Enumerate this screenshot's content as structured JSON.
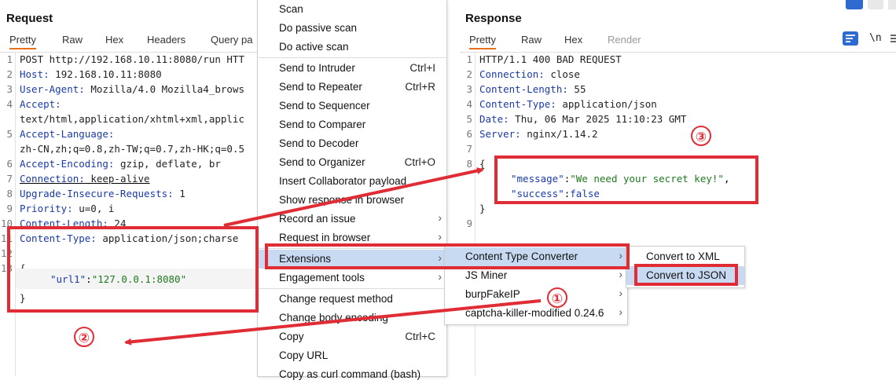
{
  "request": {
    "title": "Request",
    "tabs": [
      "Pretty",
      "Raw",
      "Hex",
      "Headers",
      "Query pa"
    ],
    "lines": [
      {
        "n": "1",
        "k": "",
        "v": "POST http://192.168.10.11:8080/run HTT"
      },
      {
        "n": "2",
        "k": "Host:",
        "v": " 192.168.10.11:8080"
      },
      {
        "n": "3",
        "k": "User-Agent:",
        "v": " Mozilla/4.0 Mozilla4_brows"
      },
      {
        "n": "4",
        "k": "Accept:",
        "v": ""
      },
      {
        "n": "",
        "k": "",
        "v": "text/html,application/xhtml+xml,applic"
      },
      {
        "n": "5",
        "k": "Accept-Language:",
        "v": ""
      },
      {
        "n": "",
        "k": "",
        "v": "zh-CN,zh;q=0.8,zh-TW;q=0.7,zh-HK;q=0.5"
      },
      {
        "n": "6",
        "k": "Accept-Encoding:",
        "v": " gzip, deflate, br"
      },
      {
        "n": "7",
        "k": "Connection:",
        "v": " keep-alive"
      },
      {
        "n": "8",
        "k": "Upgrade-Insecure-Requests:",
        "v": " 1"
      },
      {
        "n": "9",
        "k": "Priority:",
        "v": " u=0, i"
      },
      {
        "n": "10",
        "k": "Content-Length:",
        "v": " 24"
      },
      {
        "n": "11",
        "k": "Content-Type:",
        "v": " application/json;charse"
      },
      {
        "n": "12",
        "k": "",
        "v": ""
      },
      {
        "n": "13",
        "k": "",
        "v": "{"
      },
      {
        "n": "",
        "k": "",
        "v": ""
      },
      {
        "n": "",
        "k": "",
        "v": "}"
      }
    ],
    "json_key": "\"url1\"",
    "json_colon": ":",
    "json_val": "\"127.0.0.1:8080\""
  },
  "response": {
    "title": "Response",
    "tabs": [
      "Pretty",
      "Raw",
      "Hex",
      "Render"
    ],
    "toolbar_newline": "\\n",
    "lines": [
      {
        "n": "1",
        "k": "",
        "v": "HTTP/1.1 400 BAD REQUEST"
      },
      {
        "n": "2",
        "k": "Connection:",
        "v": " close"
      },
      {
        "n": "3",
        "k": "Content-Length:",
        "v": " 55"
      },
      {
        "n": "4",
        "k": "Content-Type:",
        "v": " application/json"
      },
      {
        "n": "5",
        "k": "Date:",
        "v": " Thu, 06 Mar 2025 11:10:23 GMT"
      },
      {
        "n": "6",
        "k": "Server:",
        "v": " nginx/1.14.2"
      },
      {
        "n": "7",
        "k": "",
        "v": ""
      },
      {
        "n": "8",
        "k": "",
        "v": "{"
      },
      {
        "n": "",
        "k": "",
        "v": ""
      },
      {
        "n": "",
        "k": "",
        "v": ""
      },
      {
        "n": "",
        "k": "",
        "v": "}"
      },
      {
        "n": "9",
        "k": "",
        "v": ""
      }
    ],
    "message_key": "\"message\"",
    "message_val": "\"We need your secret key!\"",
    "success_key": "\"success\"",
    "success_val": "false"
  },
  "context_menu": {
    "items": [
      {
        "label": "Scan",
        "shortcut": "",
        "arrow": false
      },
      {
        "label": "Do passive scan",
        "shortcut": "",
        "arrow": false
      },
      {
        "label": "Do active scan",
        "shortcut": "",
        "arrow": false
      },
      {
        "sep": true
      },
      {
        "label": "Send to Intruder",
        "shortcut": "Ctrl+I",
        "arrow": false
      },
      {
        "label": "Send to Repeater",
        "shortcut": "Ctrl+R",
        "arrow": false
      },
      {
        "label": "Send to Sequencer",
        "shortcut": "",
        "arrow": false
      },
      {
        "label": "Send to Comparer",
        "shortcut": "",
        "arrow": false
      },
      {
        "label": "Send to Decoder",
        "shortcut": "",
        "arrow": false
      },
      {
        "label": "Send to Organizer",
        "shortcut": "Ctrl+O",
        "arrow": false
      },
      {
        "label": "Insert Collaborator payload",
        "shortcut": "",
        "arrow": false
      },
      {
        "label": "Show response in browser",
        "shortcut": "",
        "arrow": false
      },
      {
        "label": "Record an issue",
        "shortcut": "",
        "arrow": true
      },
      {
        "label": "Request in browser",
        "shortcut": "",
        "arrow": true
      },
      {
        "sep": true
      },
      {
        "label": "Extensions",
        "shortcut": "",
        "arrow": true,
        "selected": true
      },
      {
        "label": "Engagement tools",
        "shortcut": "",
        "arrow": true
      },
      {
        "sep": true
      },
      {
        "label": "Change request method",
        "shortcut": "",
        "arrow": false
      },
      {
        "label": "Change body encoding",
        "shortcut": "",
        "arrow": false
      },
      {
        "label": "Copy",
        "shortcut": "Ctrl+C",
        "arrow": false
      },
      {
        "label": "Copy URL",
        "shortcut": "",
        "arrow": false
      },
      {
        "label": "Copy as curl command (bash)",
        "shortcut": "",
        "arrow": false
      }
    ]
  },
  "extensions_menu": {
    "items": [
      {
        "label": "Content Type Converter",
        "arrow": true,
        "selected": true
      },
      {
        "label": "JS Miner",
        "arrow": true
      },
      {
        "label": "burpFakeIP",
        "arrow": true
      },
      {
        "label": "captcha-killer-modified 0.24.6",
        "arrow": true
      }
    ]
  },
  "converter_menu": {
    "items": [
      {
        "label": "Convert to XML"
      },
      {
        "label": "Convert to JSON",
        "selected": true
      }
    ]
  },
  "annotations": {
    "n1": "①",
    "n2": "②",
    "n3": "③",
    "color": "#e02d35"
  }
}
